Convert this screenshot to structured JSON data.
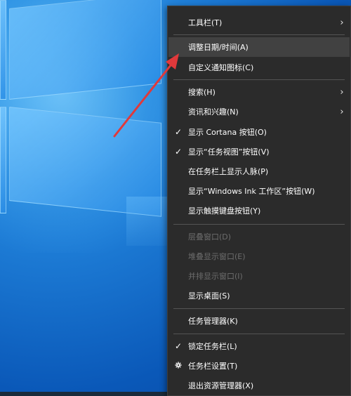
{
  "menu": {
    "items": [
      {
        "label": "工具栏(T)",
        "checked": false,
        "submenu": true,
        "disabled": false,
        "icon": null
      },
      {
        "label": "调整日期/时间(A)",
        "checked": false,
        "submenu": false,
        "disabled": false,
        "icon": null,
        "highlighted": true
      },
      {
        "label": "自定义通知图标(C)",
        "checked": false,
        "submenu": false,
        "disabled": false,
        "icon": null
      },
      {
        "label": "搜索(H)",
        "checked": false,
        "submenu": true,
        "disabled": false,
        "icon": null
      },
      {
        "label": "资讯和兴趣(N)",
        "checked": false,
        "submenu": true,
        "disabled": false,
        "icon": null
      },
      {
        "label": "显示 Cortana 按钮(O)",
        "checked": true,
        "submenu": false,
        "disabled": false,
        "icon": null
      },
      {
        "label": "显示“任务视图”按钮(V)",
        "checked": true,
        "submenu": false,
        "disabled": false,
        "icon": null
      },
      {
        "label": "在任务栏上显示人脉(P)",
        "checked": false,
        "submenu": false,
        "disabled": false,
        "icon": null
      },
      {
        "label": "显示“Windows Ink 工作区”按钮(W)",
        "checked": false,
        "submenu": false,
        "disabled": false,
        "icon": null
      },
      {
        "label": "显示触摸键盘按钮(Y)",
        "checked": false,
        "submenu": false,
        "disabled": false,
        "icon": null
      },
      {
        "label": "层叠窗口(D)",
        "checked": false,
        "submenu": false,
        "disabled": true,
        "icon": null
      },
      {
        "label": "堆叠显示窗口(E)",
        "checked": false,
        "submenu": false,
        "disabled": true,
        "icon": null
      },
      {
        "label": "并排显示窗口(I)",
        "checked": false,
        "submenu": false,
        "disabled": true,
        "icon": null
      },
      {
        "label": "显示桌面(S)",
        "checked": false,
        "submenu": false,
        "disabled": false,
        "icon": null
      },
      {
        "label": "任务管理器(K)",
        "checked": false,
        "submenu": false,
        "disabled": false,
        "icon": null
      },
      {
        "label": "锁定任务栏(L)",
        "checked": true,
        "submenu": false,
        "disabled": false,
        "icon": null
      },
      {
        "label": "任务栏设置(T)",
        "checked": false,
        "submenu": false,
        "disabled": false,
        "icon": "gear-icon"
      },
      {
        "label": "退出资源管理器(X)",
        "checked": false,
        "submenu": false,
        "disabled": false,
        "icon": null
      }
    ],
    "check_glyph": "✓",
    "submenu_glyph": "›"
  },
  "colors": {
    "menu_bg": "#2b2b2b",
    "hover_bg": "#414141",
    "disabled_text": "#6d6d6d",
    "annotation_arrow": "#e0393b"
  }
}
